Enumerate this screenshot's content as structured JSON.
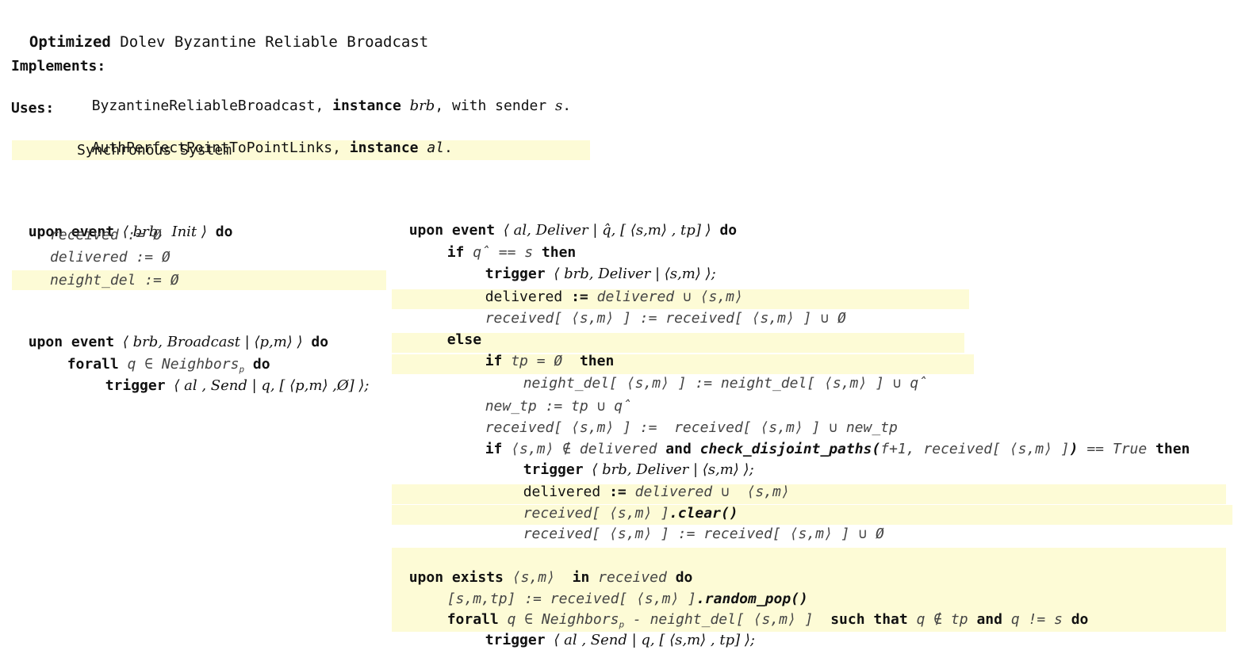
{
  "header": {
    "title_bold": "Optimized",
    "title_rest": " Dolev Byzantine Reliable Broadcast",
    "implements_label": "Implements:",
    "implements_pre": "ByzantineReliableBroadcast, ",
    "implements_kw": "instance",
    "implements_inst": "brb",
    "implements_post": ", with sender ",
    "implements_sender": "s",
    "implements_end": ".",
    "uses_label": "Uses:",
    "uses_pre": "AuthPerfectPointToPointLinks, ",
    "uses_kw": "instance",
    "uses_inst": "al",
    "uses_end": ".",
    "sync_line": "Synchronous System"
  },
  "init_block": {
    "kw": "upon event",
    "event": "⟨ brb,  Init ⟩",
    "do": "do",
    "line1": "received := Ø",
    "line2": "delivered := Ø",
    "line3": "neight_del := Ø"
  },
  "broadcast_block": {
    "kw": "upon event",
    "event": "⟨ brb, Broadcast | ⟨p,m⟩ ⟩",
    "do": "do",
    "forall_kw": "forall",
    "forall_var": "q ∈ Neighbors",
    "forall_sub": "p",
    "forall_do": "do",
    "trigger_kw": "trigger",
    "trigger_body": "⟨ al , Send | q, [ ⟨p,m⟩ ,Ø] ⟩;"
  },
  "deliver_block": {
    "header_kw": "upon event",
    "header_event": "⟨ al, Deliver | q̂, [ ⟨s,m⟩ , tp] ⟩",
    "header_do": "do",
    "if_kw": "if",
    "if_cond": "q̂ == s",
    "then_kw": "then",
    "t1_kw": "trigger",
    "t1_body": "⟨ brb, Deliver | ⟨s,m⟩ ⟩;",
    "l_delivered_pre": "delivered",
    "l_delivered_assign": ":=",
    "l_delivered_post": "delivered ∪ ⟨s,m⟩",
    "l_received_1": "received[ ⟨s,m⟩ ] := received[ ⟨s,m⟩ ] ∪ Ø",
    "else_kw": "else",
    "if2_kw": "if",
    "if2_cond": "tp = Ø",
    "then2_kw": "then",
    "l_neight": "neight_del[ ⟨s,m⟩ ] := neight_del[ ⟨s,m⟩ ] ∪ q̂",
    "l_newtp": "new_tp := tp ∪ q̂",
    "l_received_2": "received[ ⟨s,m⟩ ] :=  received[ ⟨s,m⟩ ] ∪ new_tp",
    "if3_kw": "if",
    "if3_a": "⟨s,m⟩ ∉ delivered",
    "if3_and": "and",
    "if3_fn": "check_disjoint_paths(",
    "if3_args": "f+1, received[ ⟨s,m⟩ ]",
    "if3_close": ")",
    "if3_cmp": "== True",
    "then3_kw": "then",
    "t2_kw": "trigger",
    "t2_body": "⟨ brb, Deliver | ⟨s,m⟩ ⟩;",
    "l_delivered2_pre": "delivered",
    "l_delivered2_assign": ":=",
    "l_delivered2_post": "delivered ∪  ⟨s,m⟩",
    "l_clear_pre": "received[ ⟨s,m⟩ ]",
    "l_clear_fn": ".clear()",
    "l_received_3": "received[ ⟨s,m⟩ ] := received[ ⟨s,m⟩ ] ∪ Ø"
  },
  "exists_block": {
    "kw": "upon exists",
    "var": "⟨s,m⟩",
    "in_kw": "in",
    "set": "received",
    "do": "do",
    "pop_pre": "[s,m,tp] := received[ ⟨s,m⟩ ]",
    "pop_fn": ".random_pop()",
    "forall_kw": "forall",
    "forall_a": "q ∈ Neighbors",
    "forall_sub": "p",
    "forall_b": " - neight_del[ ⟨s,m⟩ ]",
    "such_kw": "such that",
    "cond_a": "q ∉ tp",
    "and_kw": "and",
    "cond_b": "q != s",
    "do2": "do",
    "trigger_kw": "trigger",
    "trigger_body": "⟨ al , Send | q, [ ⟨s,m⟩ , tp] ⟩;"
  }
}
